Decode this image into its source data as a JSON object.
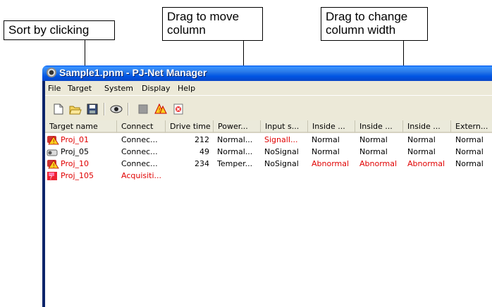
{
  "callouts": {
    "sort": "Sort by clicking",
    "move_line1": "Drag to move",
    "move_line2": "column",
    "width_line1": "Drag to change",
    "width_line2": "column width"
  },
  "window": {
    "title": "Sample1.pnm - PJ-Net Manager"
  },
  "menu": [
    "File",
    "Target",
    "System",
    "Display",
    "Help"
  ],
  "toolbar": [
    {
      "icon": "new-document-icon"
    },
    {
      "icon": "open-folder-icon"
    },
    {
      "icon": "save-disk-icon"
    },
    {
      "icon": "eye-monitor-icon"
    },
    {
      "icon": "stop-icon"
    },
    {
      "icon": "warning-signal-icon"
    },
    {
      "icon": "error-report-icon"
    }
  ],
  "columns": [
    "Target name",
    "Connect",
    "Drive time",
    "Power...",
    "Input s...",
    "Inside ...",
    "Inside ...",
    "Inside ...",
    "Extern..."
  ],
  "rows": [
    {
      "name": "Proj_01",
      "status_icon": "warning-icon",
      "connect": "Connec...",
      "drive_time": "212",
      "power": "Normal...",
      "input": "SignalI...",
      "inside1": "Normal",
      "inside2": "Normal",
      "inside3": "Normal",
      "extern": "Normal",
      "colors": {
        "name": "#e00000",
        "connect": "#000000",
        "input": "#e00000",
        "inside1": "#000000",
        "inside2": "#000000",
        "inside3": "#000000"
      }
    },
    {
      "name": "Proj_05",
      "status_icon": "projector-ok-icon",
      "connect": "Connec...",
      "drive_time": "49",
      "power": "Normal...",
      "input": "NoSignal",
      "inside1": "Normal",
      "inside2": "Normal",
      "inside3": "Normal",
      "extern": "Normal",
      "colors": {
        "name": "#000000",
        "connect": "#000000",
        "input": "#000000",
        "inside1": "#000000",
        "inside2": "#000000",
        "inside3": "#000000"
      }
    },
    {
      "name": "Proj_10",
      "status_icon": "warning-icon",
      "connect": "Connec...",
      "drive_time": "234",
      "power": "Temper...",
      "input": "NoSignal",
      "inside1": "Abnormal",
      "inside2": "Abnormal",
      "inside3": "Abnormal",
      "extern": "Normal",
      "colors": {
        "name": "#e00000",
        "connect": "#000000",
        "input": "#000000",
        "inside1": "#e00000",
        "inside2": "#e00000",
        "inside3": "#e00000"
      }
    },
    {
      "name": "Proj_105",
      "status_icon": "acquisition-error-icon",
      "connect": "Acquisiti...",
      "drive_time": "",
      "power": "",
      "input": "",
      "inside1": "",
      "inside2": "",
      "inside3": "",
      "extern": "",
      "colors": {
        "name": "#e00000",
        "connect": "#e00000",
        "input": "#000000",
        "inside1": "#000000",
        "inside2": "#000000",
        "inside3": "#000000"
      }
    }
  ]
}
